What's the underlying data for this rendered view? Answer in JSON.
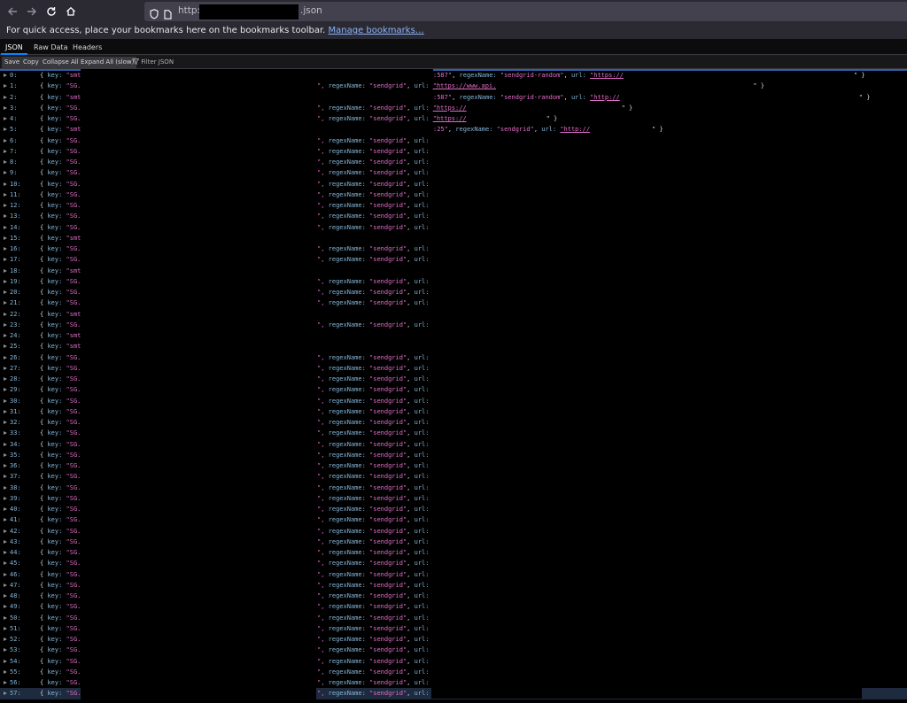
{
  "browser": {
    "url_prefix": "http://",
    "url_suffix": ".json",
    "bookmarks_hint": "For quick access, place your bookmarks here on the bookmarks toolbar.",
    "bookmarks_link": "Manage bookmarks…"
  },
  "viewer": {
    "tabs": [
      "JSON",
      "Raw Data",
      "Headers"
    ],
    "toolbar": {
      "save": "Save",
      "copy": "Copy",
      "collapse": "Collapse All",
      "expand": "Expand All (slow)",
      "filter_placeholder": "Filter JSON"
    }
  },
  "json_rows": {
    "key_label": "key:",
    "regex_label": "regexName:",
    "url_label": "url:",
    "open": "{",
    "close": "}",
    "items": [
      {
        "index": "0:",
        "prefix": "\"smt",
        "tail": "",
        "ext": ":587\", regexName: \"sendgrid-random\", url: \"https://",
        "close": "\" }"
      },
      {
        "index": "1:",
        "prefix": "\"SG.",
        "tail": "\", regexName: \"sendgrid\", url: \"https://www.api.",
        "close": "\" }"
      },
      {
        "index": "2:",
        "prefix": "\"smt",
        "tail": "",
        "ext": ":587\", regexName: \"sendgrid-random\", url: \"http://",
        "close": "\" }"
      },
      {
        "index": "3:",
        "prefix": "\"SG.",
        "tail": "\", regexName: \"sendgrid\", url: \"https://",
        "close": "\" }"
      },
      {
        "index": "4:",
        "prefix": "\"SG.",
        "tail": "\", regexName: \"sendgrid\", url: \"https://",
        "close": "\" }"
      },
      {
        "index": "5:",
        "prefix": "\"smt",
        "tail": "",
        "ext": ":25\", regexName: \"sendgrid\", url: \"http://",
        "close": "\" }"
      },
      {
        "index": "6:",
        "prefix": "\"SG.",
        "tail": "\", regexName: \"sendgrid\", url: \""
      },
      {
        "index": "7:",
        "prefix": "\"SG.",
        "tail": "\", regexName: \"sendgrid\", url: \""
      },
      {
        "index": "8:",
        "prefix": "\"SG.",
        "tail": "\", regexName: \"sendgrid\", url: \""
      },
      {
        "index": "9:",
        "prefix": "\"SG.",
        "tail": "\", regexName: \"sendgrid\", url: \""
      },
      {
        "index": "10:",
        "prefix": "\"SG.",
        "tail": "\", regexName: \"sendgrid\", url: \""
      },
      {
        "index": "11:",
        "prefix": "\"SG.",
        "tail": "\", regexName: \"sendgrid\", url: \""
      },
      {
        "index": "12:",
        "prefix": "\"SG.",
        "tail": "\", regexName: \"sendgrid\", url: \""
      },
      {
        "index": "13:",
        "prefix": "\"SG.",
        "tail": "\", regexName: \"sendgrid\", url: \""
      },
      {
        "index": "14:",
        "prefix": "\"SG.",
        "tail": "\", regexName: \"sendgrid\", url: \""
      },
      {
        "index": "15:",
        "prefix": "\"smt",
        "tail": ""
      },
      {
        "index": "16:",
        "prefix": "\"SG.",
        "tail": "\", regexName: \"sendgrid\", url: \""
      },
      {
        "index": "17:",
        "prefix": "\"SG.",
        "tail": "\", regexName: \"sendgrid\", url: \""
      },
      {
        "index": "18:",
        "prefix": "\"smt",
        "tail": ""
      },
      {
        "index": "19:",
        "prefix": "\"SG.",
        "tail": "\", regexName: \"sendgrid\", url: \""
      },
      {
        "index": "20:",
        "prefix": "\"SG.",
        "tail": "\", regexName: \"sendgrid\", url: \""
      },
      {
        "index": "21:",
        "prefix": "\"SG.",
        "tail": "\", regexName: \"sendgrid\", url: \""
      },
      {
        "index": "22:",
        "prefix": "\"smt",
        "tail": ""
      },
      {
        "index": "23:",
        "prefix": "\"SG.",
        "tail": "\", regexName: \"sendgrid\", url: \""
      },
      {
        "index": "24:",
        "prefix": "\"smt",
        "tail": ""
      },
      {
        "index": "25:",
        "prefix": "\"smt",
        "tail": ""
      },
      {
        "index": "26:",
        "prefix": "\"SG.",
        "tail": "\", regexName: \"sendgrid\", url: \""
      },
      {
        "index": "27:",
        "prefix": "\"SG.",
        "tail": "\", regexName: \"sendgrid\", url: \""
      },
      {
        "index": "28:",
        "prefix": "\"SG.",
        "tail": "\", regexName: \"sendgrid\", url: \""
      },
      {
        "index": "29:",
        "prefix": "\"SG.",
        "tail": "\", regexName: \"sendgrid\", url: \""
      },
      {
        "index": "30:",
        "prefix": "\"SG.",
        "tail": "\", regexName: \"sendgrid\", url: \""
      },
      {
        "index": "31:",
        "prefix": "\"SG.",
        "tail": "\", regexName: \"sendgrid\", url: \""
      },
      {
        "index": "32:",
        "prefix": "\"SG.",
        "tail": "\", regexName: \"sendgrid\", url: \""
      },
      {
        "index": "33:",
        "prefix": "\"SG.",
        "tail": "\", regexName: \"sendgrid\", url: \""
      },
      {
        "index": "34:",
        "prefix": "\"SG.",
        "tail": "\", regexName: \"sendgrid\", url: \""
      },
      {
        "index": "35:",
        "prefix": "\"SG.",
        "tail": "\", regexName: \"sendgrid\", url: \""
      },
      {
        "index": "36:",
        "prefix": "\"SG.",
        "tail": "\", regexName: \"sendgrid\", url: \""
      },
      {
        "index": "37:",
        "prefix": "\"SG.",
        "tail": "\", regexName: \"sendgrid\", url: \""
      },
      {
        "index": "38:",
        "prefix": "\"SG.",
        "tail": "\", regexName: \"sendgrid\", url: \""
      },
      {
        "index": "39:",
        "prefix": "\"SG.",
        "tail": "\", regexName: \"sendgrid\", url: \""
      },
      {
        "index": "40:",
        "prefix": "\"SG.",
        "tail": "\", regexName: \"sendgrid\", url: \""
      },
      {
        "index": "41:",
        "prefix": "\"SG.",
        "tail": "\", regexName: \"sendgrid\", url: \""
      },
      {
        "index": "42:",
        "prefix": "\"SG.",
        "tail": "\", regexName: \"sendgrid\", url: \""
      },
      {
        "index": "43:",
        "prefix": "\"SG.",
        "tail": "\", regexName: \"sendgrid\", url: \""
      },
      {
        "index": "44:",
        "prefix": "\"SG.",
        "tail": "\", regexName: \"sendgrid\", url: \""
      },
      {
        "index": "45:",
        "prefix": "\"SG.",
        "tail": "\", regexName: \"sendgrid\", url: \""
      },
      {
        "index": "46:",
        "prefix": "\"SG.",
        "tail": "\", regexName: \"sendgrid\", url: \""
      },
      {
        "index": "47:",
        "prefix": "\"SG.",
        "tail": "\", regexName: \"sendgrid\", url: \""
      },
      {
        "index": "48:",
        "prefix": "\"SG.",
        "tail": "\", regexName: \"sendgrid\", url: \""
      },
      {
        "index": "49:",
        "prefix": "\"SG.",
        "tail": "\", regexName: \"sendgrid\", url: \""
      },
      {
        "index": "50:",
        "prefix": "\"SG.",
        "tail": "\", regexName: \"sendgrid\", url: \""
      },
      {
        "index": "51:",
        "prefix": "\"SG.",
        "tail": "\", regexName: \"sendgrid\", url: \""
      },
      {
        "index": "52:",
        "prefix": "\"SG.",
        "tail": "\", regexName: \"sendgrid\", url: \""
      },
      {
        "index": "53:",
        "prefix": "\"SG.",
        "tail": "\", regexName: \"sendgrid\", url: \""
      },
      {
        "index": "54:",
        "prefix": "\"SG.",
        "tail": "\", regexName: \"sendgrid\", url: \""
      },
      {
        "index": "55:",
        "prefix": "\"SG.",
        "tail": "\", regexName: \"sendgrid\", url: \""
      },
      {
        "index": "56:",
        "prefix": "\"SG.",
        "tail": "\", regexName: \"sendgrid\", url: \""
      },
      {
        "index": "57:",
        "prefix": "\"SG.",
        "tail": "\", regexName: \"sendgrid\", url: \""
      }
    ]
  },
  "colors": {
    "chrome_bg": "#2b2a33",
    "viewer_bg": "#000000",
    "key_color": "#86b6d8",
    "string_color": "#e06ec8",
    "tab_accent": "#0a84ff"
  }
}
